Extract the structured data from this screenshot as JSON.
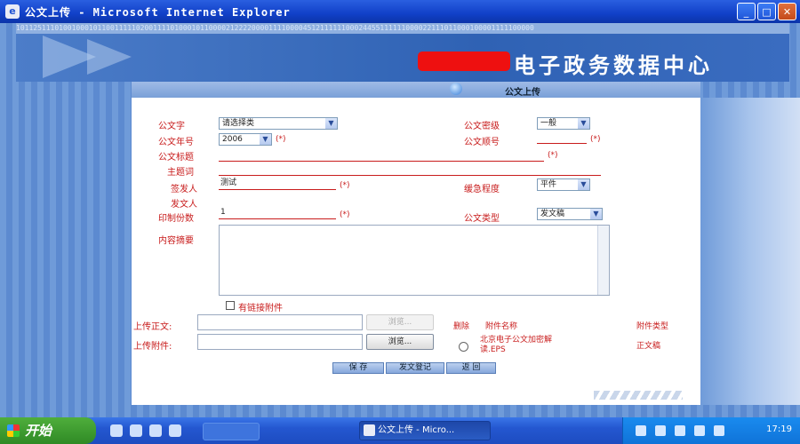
{
  "window": {
    "title": "公文上传 - Microsoft Internet Explorer",
    "icon": "ie-icon",
    "buttons": [
      "minimize",
      "maximize",
      "close"
    ]
  },
  "header": {
    "digits": "1011251110100100010110011111020011110100010110000212222000011110000451211111100024455111111000022111011000100001111100000",
    "brand_title": "电子政务数据中心"
  },
  "section_title": "公文上传",
  "form": {
    "doc_char_label": "公文字",
    "doc_char_value": "请选择类",
    "security_label": "公文密级",
    "security_value": "一般",
    "doc_year_label": "公文年号",
    "doc_year_value": "2006",
    "doc_number_label": "公文顺号",
    "doc_title_label": "公文标题",
    "main_subject_label": "主题词",
    "sender_label": "签发人",
    "sender_value": "测试",
    "urgency_label": "缓急程度",
    "urgency_value": "平件",
    "issuer_label": "发文人",
    "copies_label": "印制份数",
    "copies_value": "1",
    "doc_type_label": "公文类型",
    "doc_type_value": "发文稿",
    "summary_label": "内容摘要",
    "has_attachment_label": "有链接附件",
    "required_mark": "(*)"
  },
  "upload": {
    "main_text_label": "上传正文:",
    "attachment_label": "上传附件:",
    "browse_label": "浏览..."
  },
  "attachments": {
    "col_delete": "删除",
    "col_name": "附件名称",
    "col_type": "附件类型",
    "rows": [
      {
        "name": "北京电子公文加密解读.EPS",
        "type": "正文稿"
      }
    ]
  },
  "actions": {
    "save_label": "保 存",
    "submit_label": "发文登记",
    "back_label": "返 回"
  },
  "taskbar": {
    "start_label": "开始",
    "active_task": "公文上传 - Micro...",
    "clock": "17:19"
  }
}
